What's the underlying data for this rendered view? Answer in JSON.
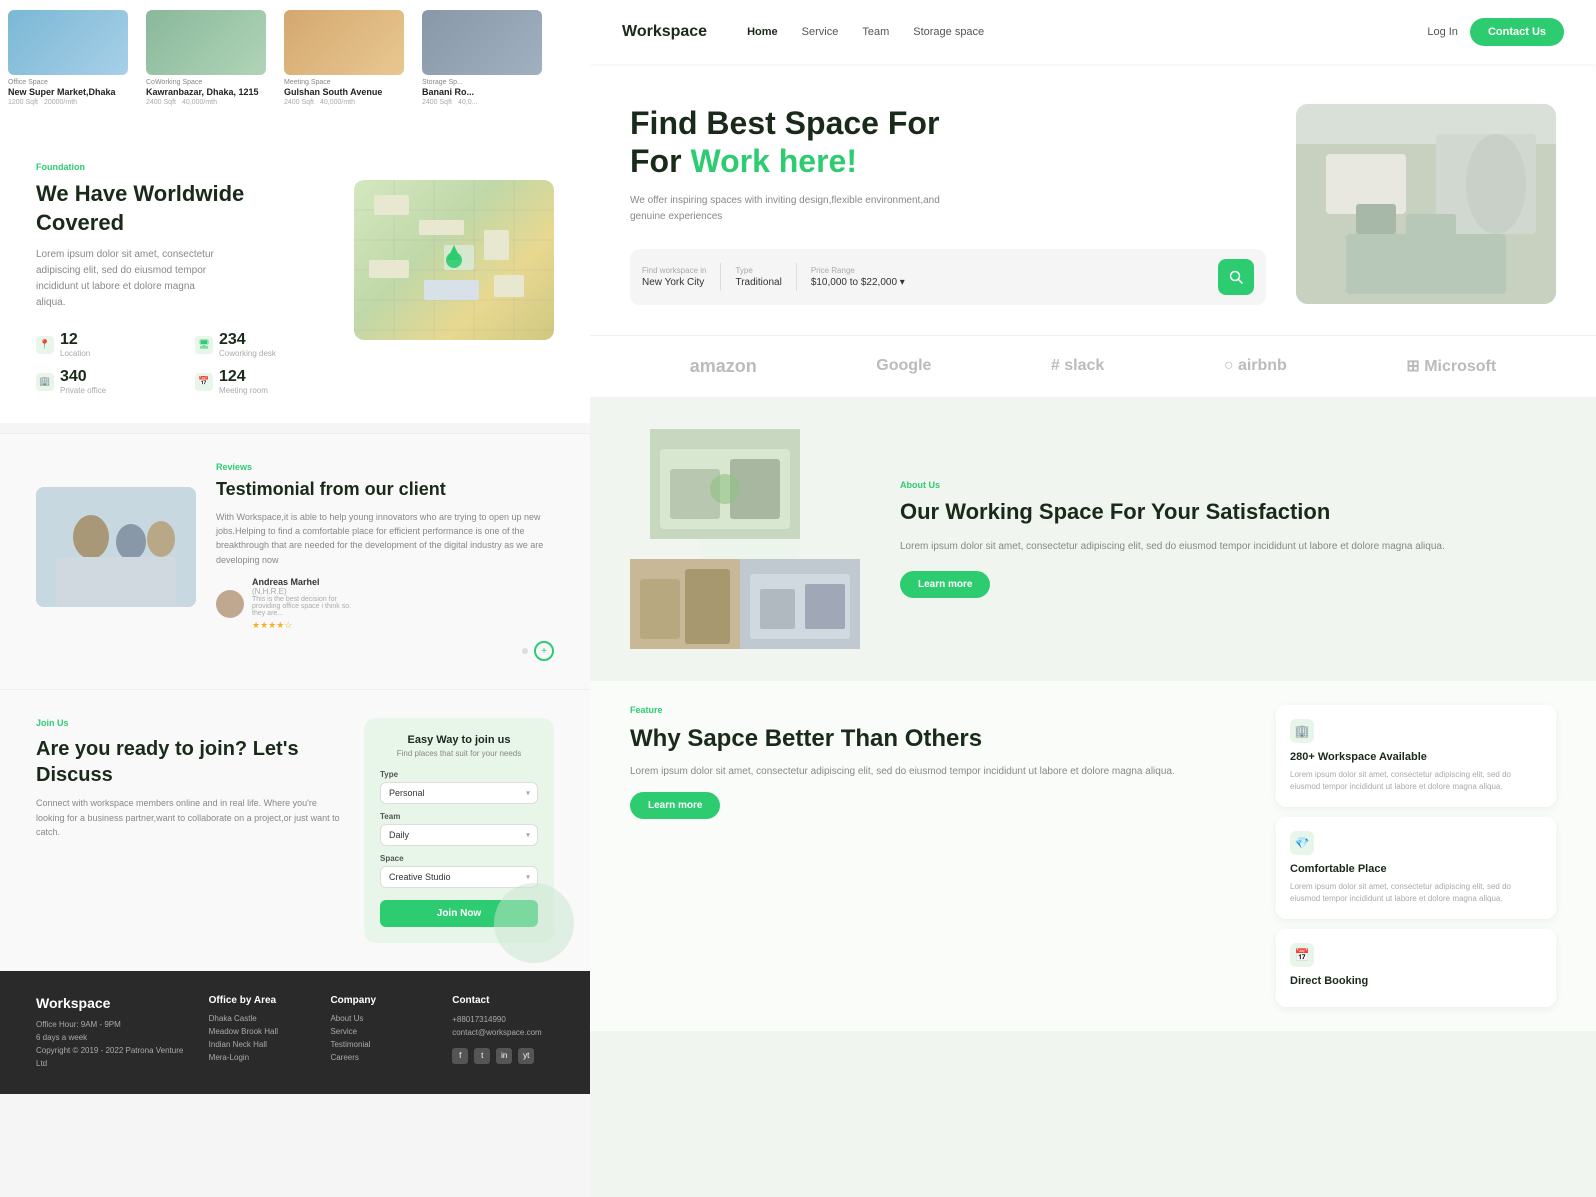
{
  "leftPanel": {
    "propertyCards": [
      {
        "type": "Office Space",
        "name": "New Super Market,Dhaka",
        "sqft": "1200 Sqft",
        "price": "20000/mth",
        "imgClass": "prop-img-blue"
      },
      {
        "type": "CoWorking Space",
        "name": "Kawranbazar, Dhaka, 1215",
        "sqft": "2400 Sqft",
        "price": "40,000/mth",
        "imgClass": "prop-img-green"
      },
      {
        "type": "Meeting Space",
        "name": "Gulshan South Avenue",
        "sqft": "2400 Sqft",
        "price": "40,000/mth",
        "imgClass": "prop-img-warm"
      },
      {
        "type": "Storage Sp...",
        "name": "Banani Ro...",
        "sqft": "2400 Sqft",
        "price": "40,0...",
        "imgClass": "prop-img-dark"
      }
    ],
    "foundation": {
      "label": "Foundation",
      "title": "We Have Worldwide Covered",
      "desc": "Lorem ipsum dolor sit amet, consectetur adipiscing elit, sed do eiusmod tempor incididunt ut labore et dolore magna aliqua.",
      "stats": [
        {
          "num": "12",
          "label": "Location",
          "icon": "📍"
        },
        {
          "num": "234",
          "label": "Coworking desk",
          "icon": "🖥"
        },
        {
          "num": "340",
          "label": "Private office",
          "icon": "🏢"
        },
        {
          "num": "124",
          "label": "Meeting room",
          "icon": "📅"
        }
      ]
    },
    "testimonial": {
      "label": "Reviews",
      "title": "Testimonial from our client",
      "body": "With Workspace,it is able to help young innovators who are trying to open up new jobs.Helping to find a comfortable place for efficient performance is one of the breakthrough that are needed for the development of the digital industry as we are developing now",
      "reviewer": {
        "name": "Andreas Marhel",
        "subname": "(N.H.R.E)",
        "quote": "This is the best decision for providing office space i think so. they are...",
        "stars": "★★★★☆"
      }
    },
    "join": {
      "label": "Join Us",
      "title": "Are you ready to join? Let's Discuss",
      "desc": "Connect with workspace members online and in real life. Where you're looking for a business partner,want to collaborate on a project,or just want to catch.",
      "form": {
        "title": "Easy Way to join us",
        "subtitle": "Find places that suit for your needs",
        "fields": [
          {
            "label": "Type",
            "value": "Personal"
          },
          {
            "label": "Team",
            "value": "Daily"
          },
          {
            "label": "Space",
            "value": "Creative Studio"
          }
        ],
        "btnLabel": "Join Now"
      }
    },
    "footer": {
      "brand": "Workspace",
      "officeHour": "Office Hour: 9AM - 9PM",
      "days": "6 days a week",
      "copyright": "Copyright © 2019 - 2022 Patrona Venture Ltd",
      "officeByArea": {
        "title": "Office by Area",
        "links": [
          "Dhaka Castle",
          "Meadow Brook Hall",
          "Indian Neck Hall",
          "Mera-Login"
        ]
      },
      "company": {
        "title": "Company",
        "links": [
          "About Us",
          "Service",
          "Testimonial",
          "Careers"
        ]
      },
      "contact": {
        "title": "Contact",
        "phone": "+88017314990",
        "email": "contact@workspace.com",
        "social": [
          "f",
          "t",
          "in",
          "yt"
        ]
      }
    }
  },
  "rightPanel": {
    "navbar": {
      "logo": "Workspace",
      "links": [
        {
          "label": "Home",
          "active": true
        },
        {
          "label": "Service",
          "active": false
        },
        {
          "label": "Team",
          "active": false
        },
        {
          "label": "Storage space",
          "active": false
        }
      ],
      "loginLabel": "Log In",
      "contactLabel": "Contact Us"
    },
    "hero": {
      "title1": "Find Best Space For",
      "title2": "For ",
      "titleGreen": "Work here!",
      "desc": "We offer inspiring spaces with inviting design,flexible environment,and genuine experiences",
      "searchBar": {
        "locationLabel": "Find workspace in",
        "locationValue": "New York City",
        "typeLabel": "Type",
        "typeValue": "Traditional",
        "priceLabel": "Price Range",
        "priceFrom": "$10,000",
        "priceTo": "$22,000"
      }
    },
    "brands": [
      "amazon",
      "Google",
      "# slack",
      "airbnb",
      "Microsoft"
    ],
    "workingSpace": {
      "aboutLabel": "About Us",
      "title": "Our Working Space For Your Satisfaction",
      "desc": "Lorem ipsum dolor sit amet, consectetur adipiscing elit, sed do eiusmod tempor incididunt ut labore et dolore magna aliqua.",
      "btnLabel": "Learn more"
    },
    "feature": {
      "featureLabel": "Feature",
      "title": "Why Sapce Better Than Others",
      "desc": "Lorem ipsum dolor sit amet, consectetur adipiscing elit, sed do eiusmod tempor incididunt ut labore et dolore magna aliqua.",
      "btnLabel": "Learn more",
      "cards": [
        {
          "icon": "🏢",
          "title": "280+ Workspace Available",
          "desc": "Lorem ipsum dolor sit amet, consectetur adipiscing elit, sed do eiusmod tempor incididunt ut labore et dolore magna aliqua."
        },
        {
          "icon": "💎",
          "title": "Comfortable Place",
          "desc": "Lorem ipsum dolor sit amet, consectetur adipiscing elit, sed do eiusmod tempor incididunt ut labore et dolore magna aliqua."
        },
        {
          "icon": "📅",
          "title": "Direct Booking",
          "desc": ""
        }
      ]
    }
  }
}
